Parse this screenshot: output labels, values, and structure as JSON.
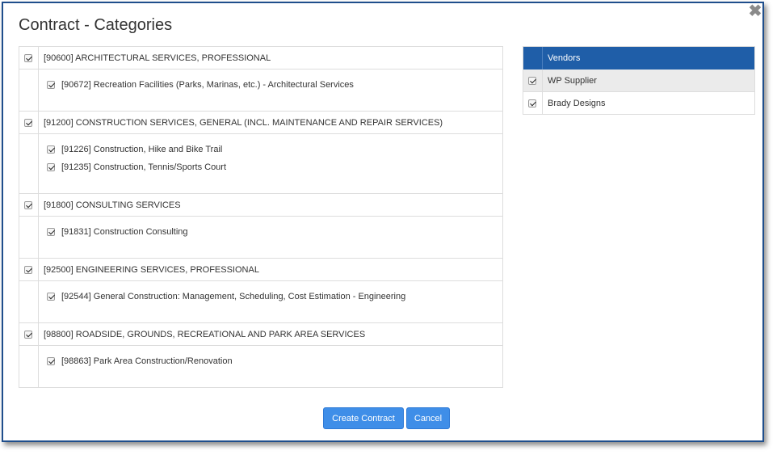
{
  "dialog": {
    "title": "Contract - Categories",
    "close_glyph": "✖"
  },
  "categories": [
    {
      "label": "[90600] ARCHITECTURAL SERVICES, PROFESSIONAL",
      "checked": true,
      "items": [
        {
          "label": "[90672] Recreation Facilities (Parks, Marinas, etc.) - Architectural Services",
          "checked": true
        }
      ]
    },
    {
      "label": "[91200] CONSTRUCTION SERVICES, GENERAL (INCL. MAINTENANCE AND REPAIR SERVICES)",
      "checked": true,
      "items": [
        {
          "label": "[91226] Construction, Hike and Bike Trail",
          "checked": true
        },
        {
          "label": "[91235] Construction, Tennis/Sports Court",
          "checked": true
        }
      ]
    },
    {
      "label": "[91800] CONSULTING SERVICES",
      "checked": true,
      "items": [
        {
          "label": "[91831] Construction Consulting",
          "checked": true
        }
      ]
    },
    {
      "label": "[92500] ENGINEERING SERVICES, PROFESSIONAL",
      "checked": true,
      "items": [
        {
          "label": "[92544] General Construction: Management, Scheduling, Cost Estimation - Engineering",
          "checked": true
        }
      ]
    },
    {
      "label": "[98800] ROADSIDE, GROUNDS, RECREATIONAL AND PARK AREA SERVICES",
      "checked": true,
      "items": [
        {
          "label": "[98863] Park Area Construction/Renovation",
          "checked": true
        }
      ]
    }
  ],
  "vendors": {
    "header": "Vendors",
    "rows": [
      {
        "label": "WP Supplier",
        "checked": true
      },
      {
        "label": "Brady Designs",
        "checked": true
      }
    ]
  },
  "buttons": {
    "create": "Create Contract",
    "cancel": "Cancel"
  },
  "colors": {
    "primary_button": "#3f8ee8",
    "vendors_header": "#1f5ea8",
    "dialog_border": "#1f4e8c"
  }
}
